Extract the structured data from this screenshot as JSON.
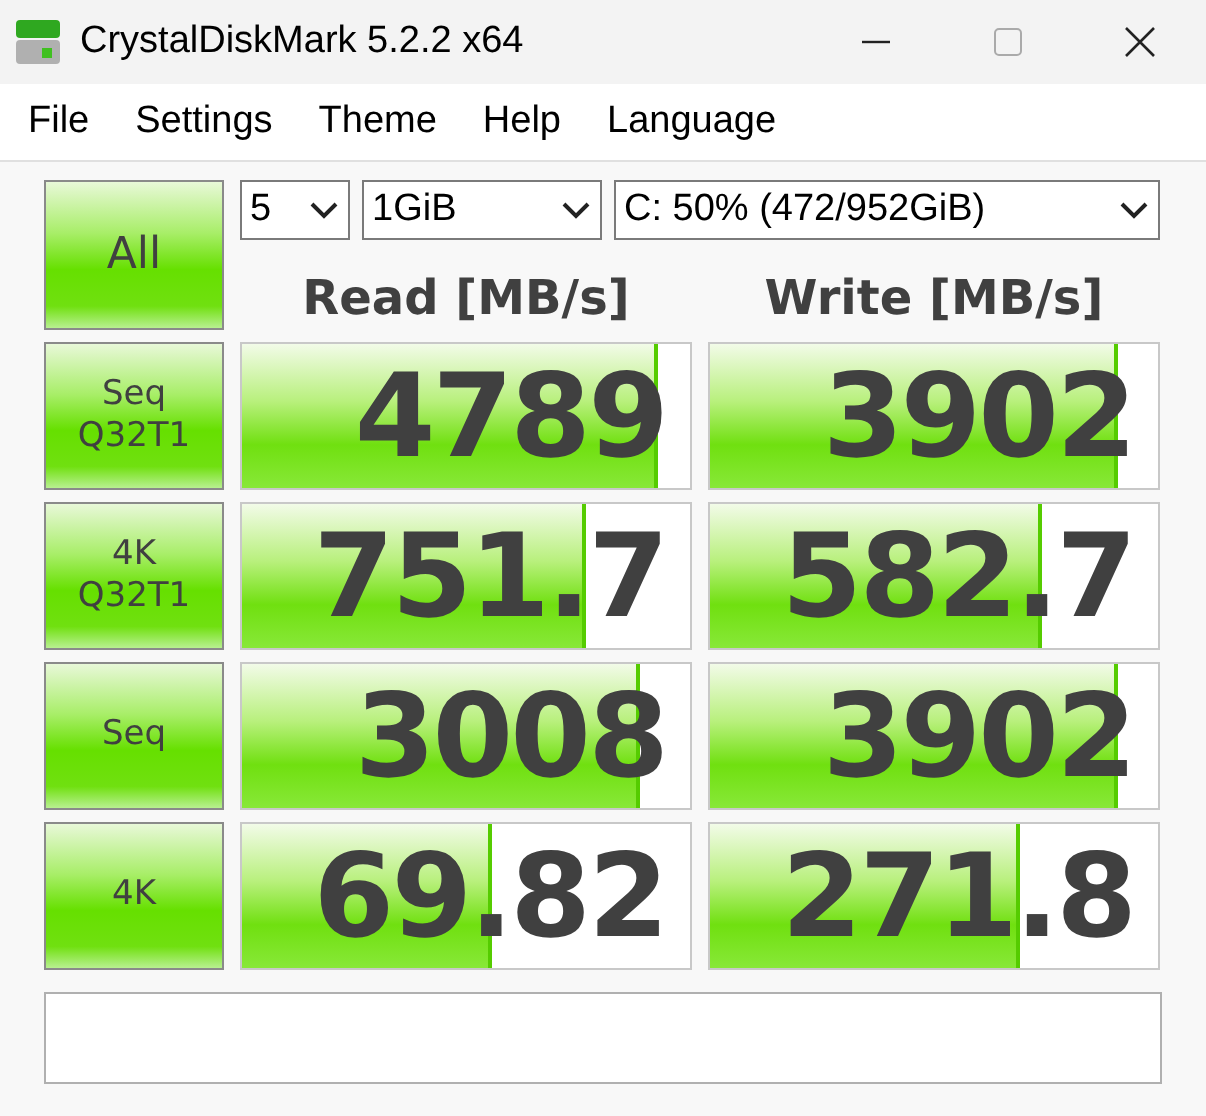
{
  "window": {
    "title": "CrystalDiskMark 5.2.2 x64"
  },
  "menu": [
    "File",
    "Settings",
    "Theme",
    "Help",
    "Language"
  ],
  "all_button": "All",
  "selectors": [
    {
      "value": "5"
    },
    {
      "value": "1GiB"
    },
    {
      "value": "C: 50% (472/952GiB)"
    }
  ],
  "columns": [
    "Read [MB/s]",
    "Write [MB/s]"
  ],
  "rows": [
    {
      "label": [
        "Seq",
        "Q32T1"
      ],
      "read": {
        "value": "4789",
        "level": 0.93
      },
      "write": {
        "value": "3902",
        "level": 0.91
      }
    },
    {
      "label": [
        "4K",
        "Q32T1"
      ],
      "read": {
        "value": "751.7",
        "level": 0.77
      },
      "write": {
        "value": "582.7",
        "level": 0.74
      }
    },
    {
      "label": [
        "Seq"
      ],
      "read": {
        "value": "3008",
        "level": 0.89
      },
      "write": {
        "value": "3902",
        "level": 0.91
      }
    },
    {
      "label": [
        "4K"
      ],
      "read": {
        "value": "69.82",
        "level": 0.56
      },
      "write": {
        "value": "271.8",
        "level": 0.69
      }
    }
  ]
}
